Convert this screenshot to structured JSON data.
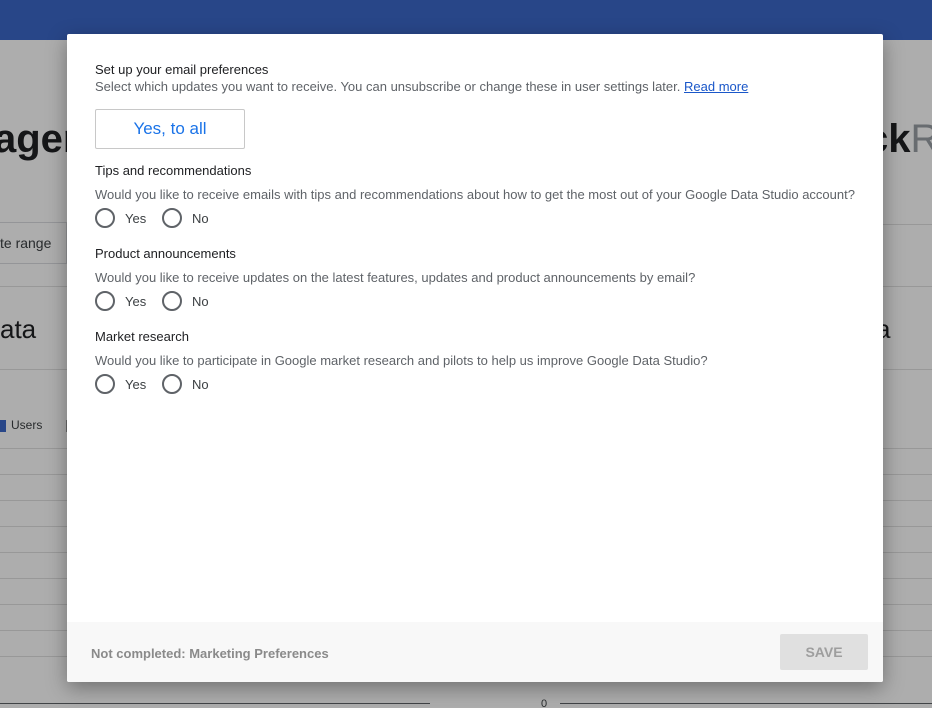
{
  "background": {
    "big_left_text": "ager",
    "big_right_text_bold": "ck",
    "big_right_text_light": "R",
    "date_range_label": "te range",
    "card_left_text": "ata",
    "card_right_text": "a",
    "legend_users": "Users",
    "axis_zero": "0",
    "colors": {
      "topbar": "#3b67c9",
      "users_series": "#3b67c9",
      "other_series": "#9e9e9e"
    }
  },
  "dialog": {
    "title": "Set up your email preferences",
    "subtitle": "Select which updates you want to receive. You can unsubscribe or change these in user settings later.",
    "read_more": "Read more",
    "yes_to_all": "Yes, to all",
    "sections": [
      {
        "heading": "Tips and recommendations",
        "question": "Would you like to receive emails with tips and recommendations about how to get the most out of your Google Data Studio account?",
        "yes": "Yes",
        "no": "No"
      },
      {
        "heading": "Product announcements",
        "question": "Would you like to receive updates on the latest features, updates and product announcements by email?",
        "yes": "Yes",
        "no": "No"
      },
      {
        "heading": "Market research",
        "question": "Would you like to participate in Google market research and pilots to help us improve Google Data Studio?",
        "yes": "Yes",
        "no": "No"
      }
    ],
    "footer_status": "Not completed: Marketing Preferences",
    "save": "SAVE",
    "colors": {
      "link": "#1a57c9",
      "accent": "#1a73e8",
      "save_disabled_bg": "#e0e0e0"
    }
  }
}
